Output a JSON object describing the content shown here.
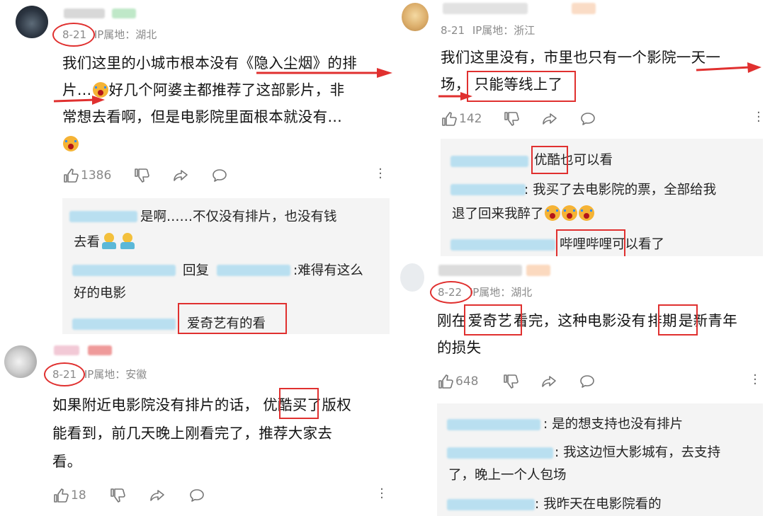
{
  "comments": [
    {
      "id": "c1",
      "date": "8-21",
      "ip": "IP属地：湖北",
      "lines": [
        "我们这里的小城市根本没有《隐入尘烟》的排",
        "片…",
        "好几个阿婆主都推荐了这部影片，非",
        "常想去看啊，但是电影院里面根本就没有…"
      ],
      "likes": "1386",
      "replies": [
        {
          "text_a": "是啊……不仅没有排片，也没有钱",
          "text_b": "去看"
        },
        {
          "prefix": "回复",
          "text_a": ":难得有这么",
          "text_b": "好的电影"
        },
        {
          "text_a": "爱奇艺有的看"
        }
      ]
    },
    {
      "id": "c2",
      "date": "8-21",
      "ip": "IP属地：浙江",
      "lines": [
        "我们这里没有，市里也只有一个影院一天一",
        "场，",
        "只能等线上了"
      ],
      "likes": "142",
      "replies": [
        {
          "hl": "优酷",
          "text_a": "也可以看"
        },
        {
          "text_a": ": 我买了去电影院的票，全部给我",
          "text_b": "退了回来我醉了"
        },
        {
          "hl": "哔哩哔哩",
          "text_a": "可以看了"
        }
      ]
    },
    {
      "id": "c3",
      "date": "8-21",
      "ip": "IP属地：安徽",
      "lines": [
        "如果附近电影院没有排片的话，",
        "优酷",
        "买了版权",
        "能看到，前几天晚上刚看完了，推荐大家去",
        "看。"
      ],
      "likes": "18"
    },
    {
      "id": "c4",
      "date": "8-22",
      "ip": "IP属地：湖北",
      "lines": [
        "刚在",
        "爱奇艺",
        "看完，这种电影没有",
        "排期",
        "是新青年",
        "的损失"
      ],
      "likes": "648",
      "replies": [
        {
          "text_a": ": 是的想支持也没有排片"
        },
        {
          "text_a": ": 我这边恒大影城有，去支持",
          "text_b": "了，晚上一个人包场"
        },
        {
          "text_a": ": 我昨天在电影院看的"
        }
      ]
    }
  ],
  "colors": {
    "accent": "#e0302f",
    "meta": "#8a8a8a",
    "reply_bg": "#f4f4f4",
    "blur": "#a9d6ea"
  },
  "icons": [
    "thumb-up-icon",
    "thumb-down-icon",
    "share-icon",
    "comment-icon",
    "more-icon"
  ]
}
